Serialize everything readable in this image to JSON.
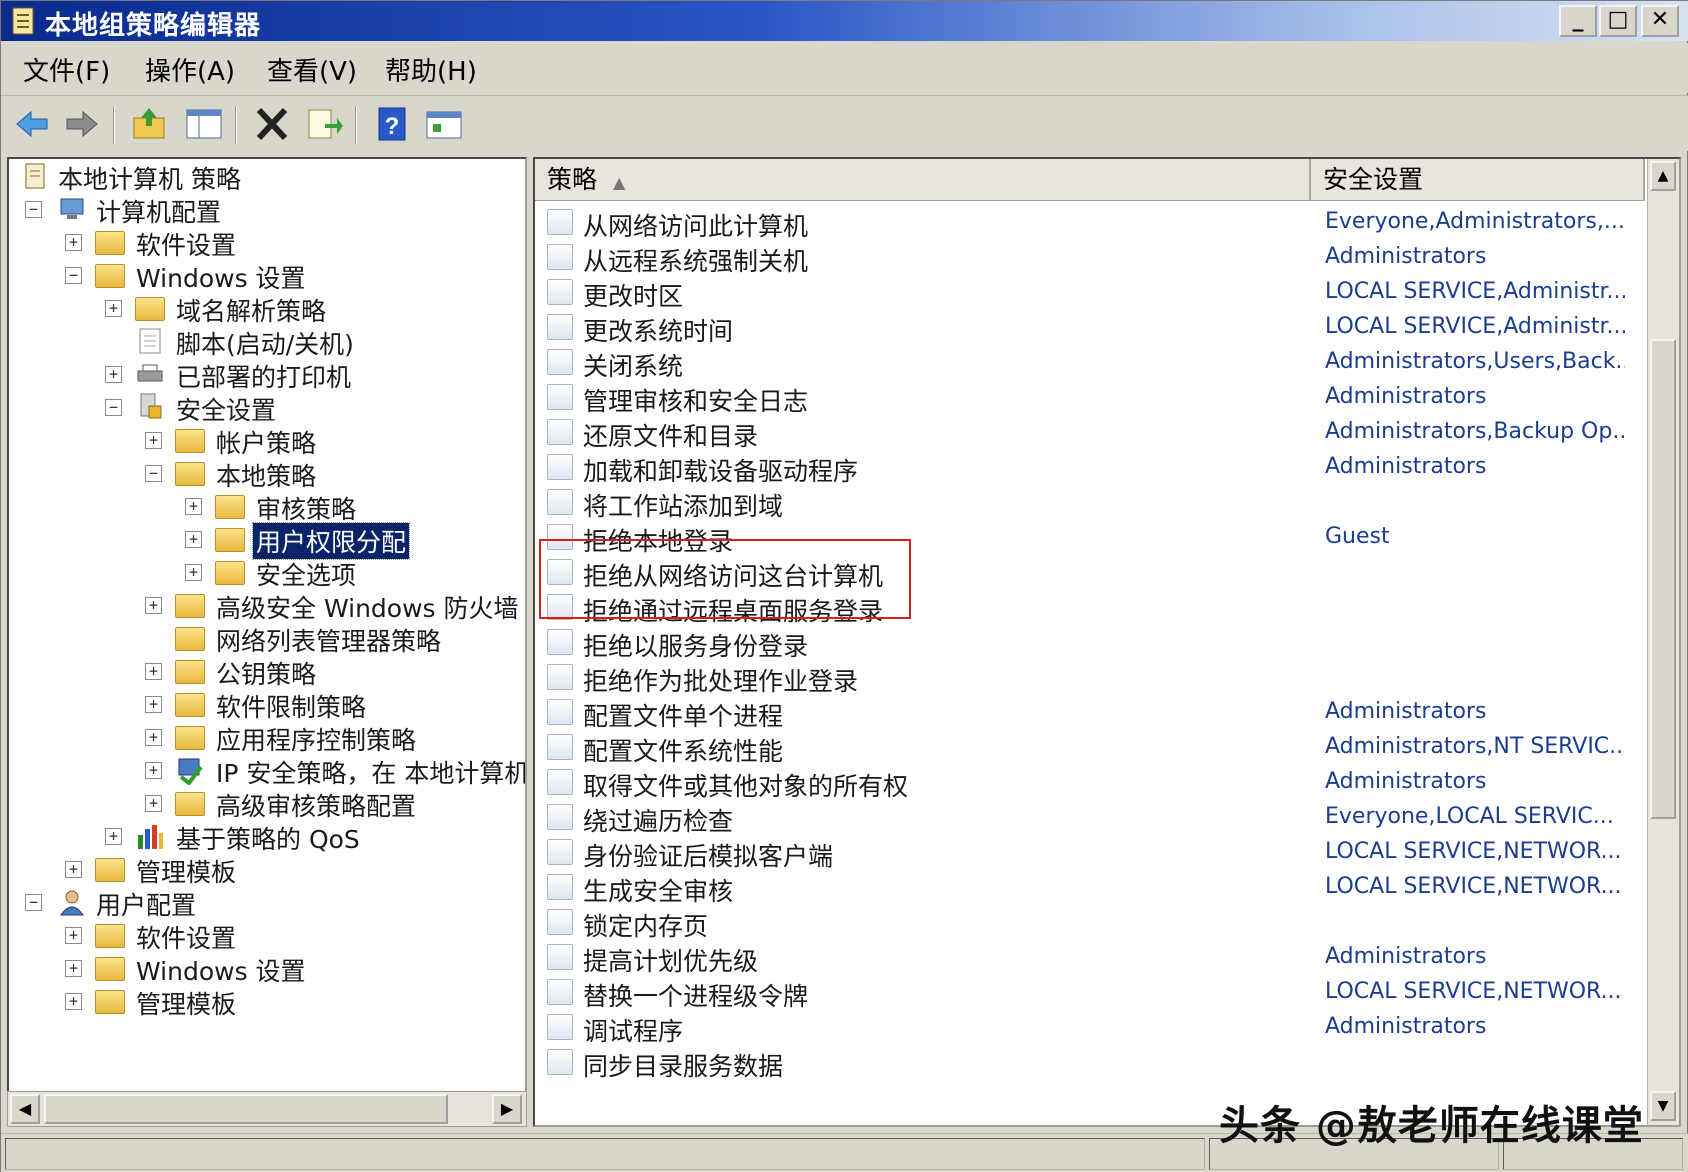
{
  "window": {
    "title": "本地组策略编辑器"
  },
  "menu": {
    "file": "文件(F)",
    "action": "操作(A)",
    "view": "查看(V)",
    "help": "帮助(H)"
  },
  "toolbar": [
    {
      "name": "back-icon"
    },
    {
      "name": "forward-icon"
    },
    {
      "name": "up-folder-icon"
    },
    {
      "name": "show-hide-tree-icon"
    },
    {
      "name": "delete-icon"
    },
    {
      "name": "export-list-icon"
    },
    {
      "name": "help-icon"
    },
    {
      "name": "properties-icon"
    }
  ],
  "tree": {
    "root": "本地计算机 策略",
    "computer_config": "计算机配置",
    "software_settings": "软件设置",
    "windows_settings": "Windows 设置",
    "dns_policy": "域名解析策略",
    "scripts": "脚本(启动/关机)",
    "printers": "已部署的打印机",
    "security_settings": "安全设置",
    "account_policy": "帐户策略",
    "local_policy": "本地策略",
    "audit_policy": "审核策略",
    "user_rights": "用户权限分配",
    "security_options": "安全选项",
    "firewall": "高级安全 Windows 防火墙",
    "network_list": "网络列表管理器策略",
    "public_key": "公钥策略",
    "software_restriction": "软件限制策略",
    "app_control": "应用程序控制策略",
    "ip_security": "IP 安全策略，在 本地计算机",
    "advanced_audit": "高级审核策略配置",
    "qos": "基于策略的 QoS",
    "admin_templates": "管理模板",
    "user_config": "用户配置",
    "user_software": "软件设置",
    "user_windows": "Windows 设置",
    "user_admin_templates": "管理模板"
  },
  "list": {
    "col_policy": "策略",
    "col_setting": "安全设置",
    "rows": [
      {
        "policy": "从网络访问此计算机",
        "setting": "Everyone,Administrators,..."
      },
      {
        "policy": "从远程系统强制关机",
        "setting": "Administrators"
      },
      {
        "policy": "更改时区",
        "setting": "LOCAL SERVICE,Administr..."
      },
      {
        "policy": "更改系统时间",
        "setting": "LOCAL SERVICE,Administr..."
      },
      {
        "policy": "关闭系统",
        "setting": "Administrators,Users,Back..."
      },
      {
        "policy": "管理审核和安全日志",
        "setting": "Administrators"
      },
      {
        "policy": "还原文件和目录",
        "setting": "Administrators,Backup Op..."
      },
      {
        "policy": "加载和卸载设备驱动程序",
        "setting": "Administrators"
      },
      {
        "policy": "将工作站添加到域",
        "setting": ""
      },
      {
        "policy": "拒绝本地登录",
        "setting": "Guest"
      },
      {
        "policy": "拒绝从网络访问这台计算机",
        "setting": ""
      },
      {
        "policy": "拒绝通过远程桌面服务登录",
        "setting": ""
      },
      {
        "policy": "拒绝以服务身份登录",
        "setting": ""
      },
      {
        "policy": "拒绝作为批处理作业登录",
        "setting": ""
      },
      {
        "policy": "配置文件单个进程",
        "setting": "Administrators"
      },
      {
        "policy": "配置文件系统性能",
        "setting": "Administrators,NT SERVIC..."
      },
      {
        "policy": "取得文件或其他对象的所有权",
        "setting": "Administrators"
      },
      {
        "policy": "绕过遍历检查",
        "setting": "Everyone,LOCAL SERVIC..."
      },
      {
        "policy": "身份验证后模拟客户端",
        "setting": "LOCAL SERVICE,NETWOR..."
      },
      {
        "policy": "生成安全审核",
        "setting": "LOCAL SERVICE,NETWOR..."
      },
      {
        "policy": "锁定内存页",
        "setting": ""
      },
      {
        "policy": "提高计划优先级",
        "setting": "Administrators"
      },
      {
        "policy": "替换一个进程级令牌",
        "setting": "LOCAL SERVICE,NETWOR..."
      },
      {
        "policy": "调试程序",
        "setting": "Administrators"
      },
      {
        "policy": "同步目录服务数据",
        "setting": ""
      }
    ]
  },
  "watermark": "头条 @敖老师在线课堂",
  "colors": {
    "title_start": "#0a2a8c",
    "selection": "#0a246a",
    "highlight_box": "#d42020",
    "setting_text": "#1b3d8f"
  }
}
